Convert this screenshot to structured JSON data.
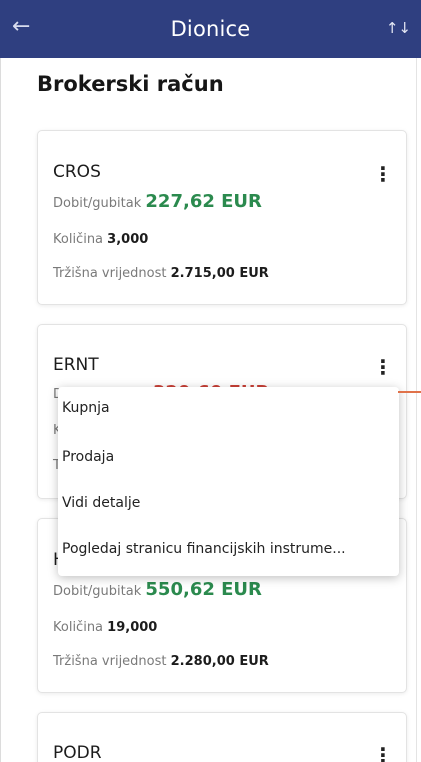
{
  "header": {
    "back_icon": "arrow-left-icon",
    "title": "Dionice",
    "sort_icon": "sort-arrows-icon",
    "sort_glyph": "↑↓",
    "color": "#2f3f80"
  },
  "section": {
    "title": "Brokerski račun"
  },
  "labels": {
    "pl": "Dobit/gubitak",
    "qty": "Količina",
    "mv": "Tržišna vrijednost"
  },
  "cards": [
    {
      "name": "CROS",
      "pl": "227,62 EUR",
      "pl_sign": "positive",
      "qty": "3,000",
      "mv": "2.715,00 EUR"
    },
    {
      "name": "ERNT",
      "pl": "-320,60 EUR",
      "pl_sign": "negative",
      "qty": "",
      "mv": ""
    },
    {
      "name": "HT",
      "pl": "550,62 EUR",
      "pl_sign": "positive",
      "qty": "19,000",
      "mv": "2.280,00 EUR"
    },
    {
      "name": "PODR",
      "pl": "",
      "pl_sign": "",
      "qty": "",
      "mv": ""
    }
  ],
  "context_menu": {
    "items": [
      "Kupnja",
      "Prodaja",
      "Vidi detalje",
      "Pogledaj stranicu financijskih instrume..."
    ]
  },
  "colors": {
    "positive": "#2b8a4e",
    "negative": "#c94036",
    "pointer": "#e0724a"
  }
}
